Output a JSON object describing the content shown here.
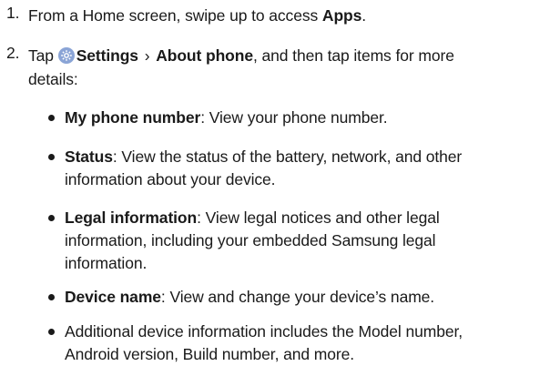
{
  "steps": [
    {
      "number": "1.",
      "text_prefix": "From a Home screen, swipe up to access ",
      "bold": "Apps",
      "text_suffix": "."
    },
    {
      "number": "2.",
      "prefix": "Tap",
      "settings_label": "Settings",
      "separator": "›",
      "about_label": "About phone",
      "suffix_line1": ", and then tap items for more",
      "suffix_line2": "details:"
    }
  ],
  "bullets": [
    {
      "title": "My phone number",
      "desc": ": View your phone number."
    },
    {
      "title": "Status",
      "desc_line1": ": View the status of the battery, network, and other",
      "desc_line2": "information about your device."
    },
    {
      "title": "Legal information",
      "desc_line1": ": View legal notices and other legal",
      "desc_line2": "information, including your embedded Samsung legal",
      "desc_line3": "information."
    },
    {
      "title": "Device name",
      "desc": ": View and change your device’s name."
    },
    {
      "line1": "Additional device information includes the Model number,",
      "line2": "Android version, Build number, and more."
    }
  ],
  "icons": {
    "settings": "gear-icon",
    "settings_color": "#8aa4d6"
  }
}
